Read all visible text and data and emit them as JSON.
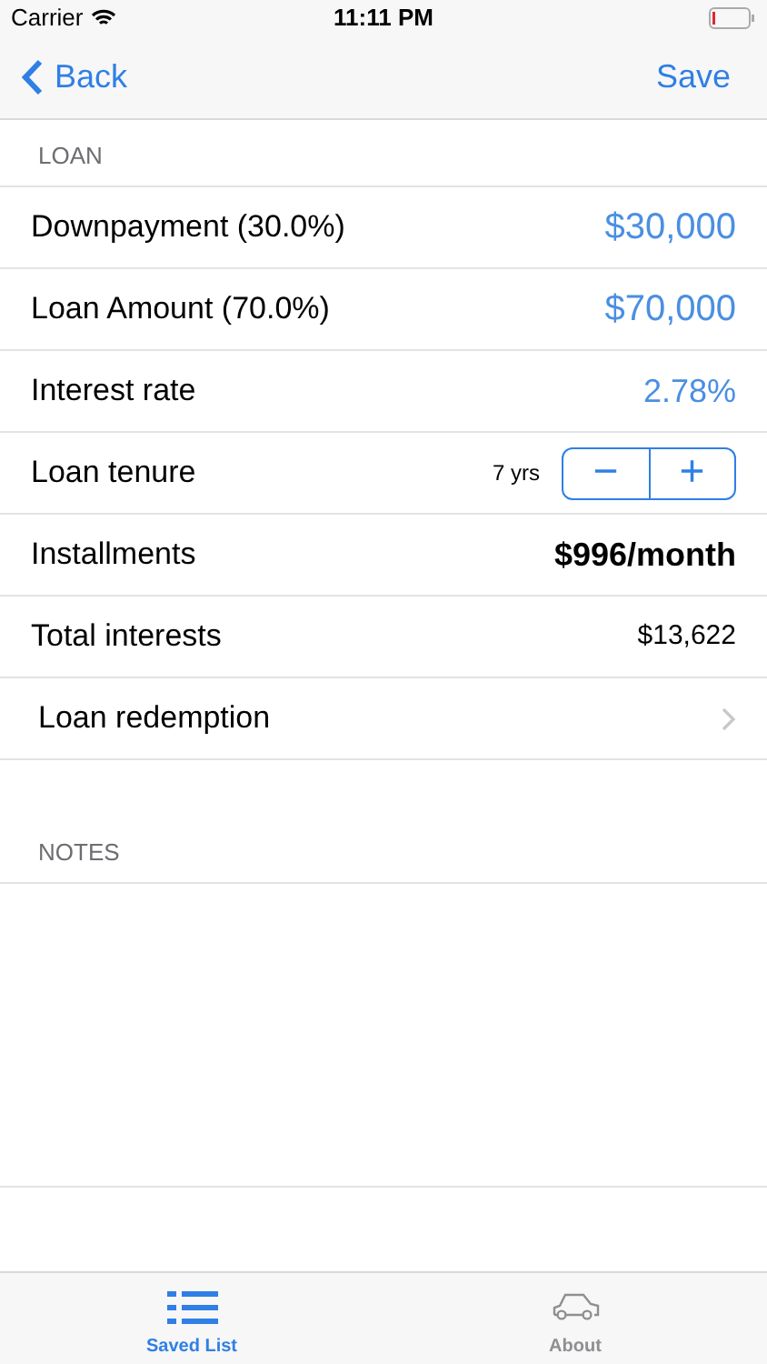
{
  "status_bar": {
    "carrier": "Carrier",
    "time": "11:11 PM"
  },
  "nav": {
    "back": "Back",
    "save": "Save"
  },
  "loan": {
    "header": "LOAN",
    "rows": [
      {
        "kind": "accent",
        "label": "Downpayment (30.0%)",
        "value": "$30,000"
      },
      {
        "kind": "accent",
        "label": "Loan Amount (70.0%)",
        "value": "$70,000"
      },
      {
        "kind": "accent-small",
        "label": "Interest rate",
        "value": "2.78%"
      },
      {
        "kind": "stepper",
        "label": "Loan tenure",
        "value": "7 yrs",
        "minus": "−",
        "plus": "+"
      },
      {
        "kind": "bold",
        "label": "Installments",
        "value": "$996/month"
      },
      {
        "kind": "plain",
        "label": "Total interests",
        "value": "$13,622"
      },
      {
        "kind": "link",
        "label": "Loan redemption"
      }
    ]
  },
  "notes": {
    "header": "NOTES"
  },
  "tabs": [
    {
      "label": "Saved List",
      "selected": true,
      "kind": "list"
    },
    {
      "label": "About",
      "selected": false,
      "kind": "car"
    }
  ]
}
